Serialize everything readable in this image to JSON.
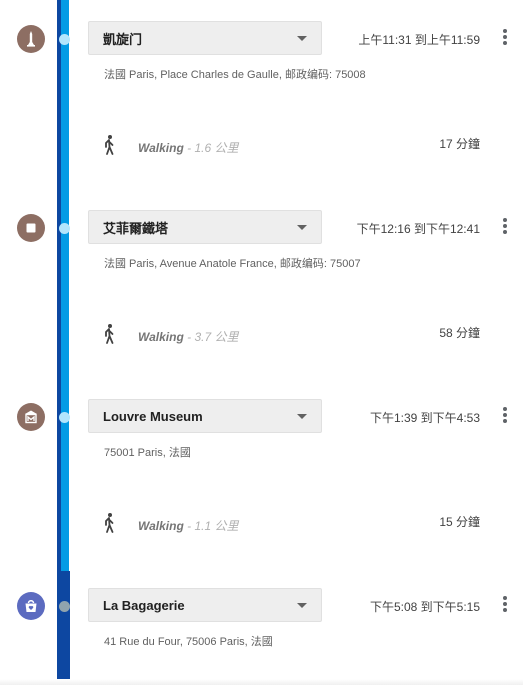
{
  "stops": [
    {
      "name": "凱旋门",
      "time": "上午11:31 到上午11:59",
      "address": "法國 Paris, Place Charles de Gaulle, 邮政编码: 75008",
      "icon": "monument-icon",
      "icon_color": "#8d6e63"
    },
    {
      "name": "艾菲爾鐵塔",
      "time": "下午12:16 到下午12:41",
      "address": "法國 Paris, Avenue Anatole France, 邮政编码: 75007",
      "icon": "landmark-square-icon",
      "icon_color": "#8d6e63"
    },
    {
      "name": "Louvre Museum",
      "time": "下午1:39 到下午4:53",
      "address": "75001 Paris, 法國",
      "icon": "museum-icon",
      "icon_color": "#8d6e63"
    },
    {
      "name": "La Bagagerie",
      "time": "下午5:08 到下午5:15",
      "address": "41 Rue du Four, 75006 Paris, 法國",
      "icon": "shopping-bag-icon",
      "icon_color": "#5c6bc0"
    }
  ],
  "legs": [
    {
      "mode": "Walking",
      "distance": "- 1.6 公里",
      "duration": "17 分鐘",
      "icon": "walking-icon"
    },
    {
      "mode": "Walking",
      "distance": "- 3.7 公里",
      "duration": "58 分鐘",
      "icon": "walking-icon"
    },
    {
      "mode": "Walking",
      "distance": "- 1.1 公里",
      "duration": "15 分鐘",
      "icon": "walking-icon"
    }
  ],
  "colors": {
    "rail_dark": "#0d47a1",
    "rail_light": "#039be5",
    "place_brown": "#8d6e63",
    "shop_indigo": "#5c6bc0"
  }
}
